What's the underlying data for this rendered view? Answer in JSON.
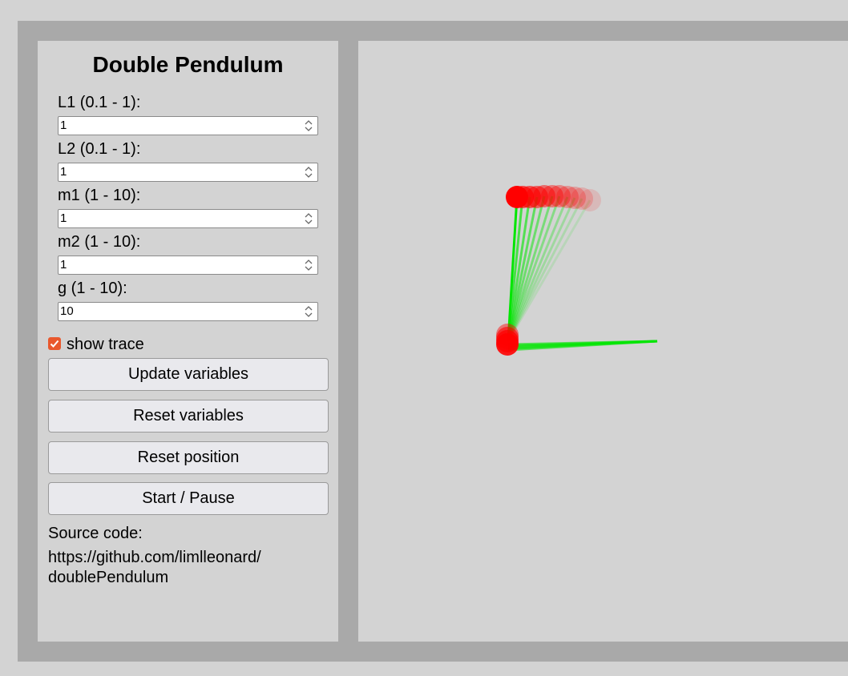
{
  "panel": {
    "title": "Double Pendulum",
    "fields": [
      {
        "label": "L1 (0.1 - 1):",
        "value": "1"
      },
      {
        "label": "L2 (0.1 - 1):",
        "value": "1"
      },
      {
        "label": "m1 (1 - 10):",
        "value": "1"
      },
      {
        "label": "m2 (1 - 10):",
        "value": "1"
      },
      {
        "label": "g (1 - 10):",
        "value": "10"
      }
    ],
    "show_trace": {
      "label": "show trace",
      "checked": true
    },
    "buttons": {
      "update": "Update variables",
      "reset_vars": "Reset variables",
      "reset_pos": "Reset position",
      "start_pause": "Start / Pause"
    },
    "source_label": "Source code:",
    "source_url_line1": "https://github.com/limlleonard/",
    "source_url_line2": "doublePendulum"
  },
  "colors": {
    "accent": "#e9582d",
    "bob": "#ff0000",
    "rod": "#00e600",
    "frame": "#a9a9a9",
    "background": "#d3d3d3"
  },
  "icons": {
    "checkbox": "checkmark-icon",
    "spinner": "spinner-arrows-icon"
  }
}
